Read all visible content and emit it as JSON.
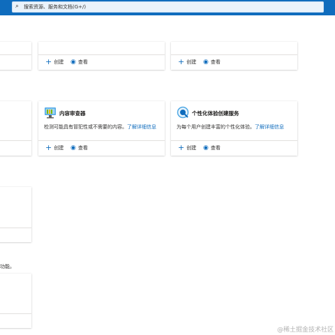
{
  "search": {
    "placeholder": "搜索资源、服务和文档(G+/)"
  },
  "actions": {
    "create_label": "创建",
    "view_label": "查看"
  },
  "cards": {
    "content_moderator": {
      "title": "内容审查器",
      "desc": "检测可能具有冒犯性或不需要的内容。",
      "link": "了解详细信息"
    },
    "personalizer": {
      "title": "个性化体验创建服务",
      "desc": "为每个用户创建丰富的个性化体验。",
      "link": "了解详细信息"
    }
  },
  "partial_text": "功能。",
  "watermark": "@稀土掘金技术社区",
  "colors": {
    "accent": "#0f6cbd",
    "topbar": "#0f6cbd"
  }
}
